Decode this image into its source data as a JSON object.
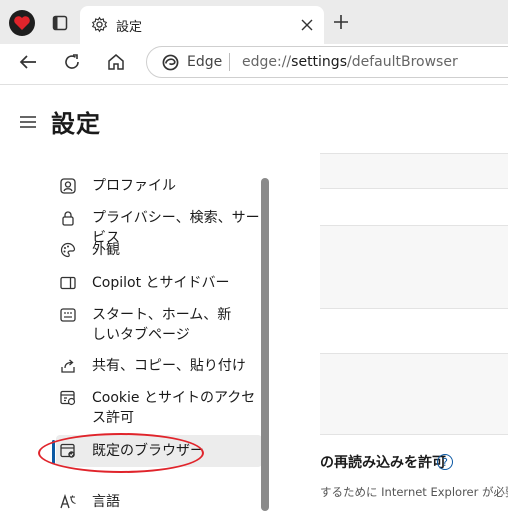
{
  "tab": {
    "title": "設定"
  },
  "address": {
    "brand": "Edge",
    "url_prefix": "edge://",
    "url_host": "settings",
    "url_path": "/defaultBrowser"
  },
  "page": {
    "title": "設定"
  },
  "sidebar": {
    "items": [
      {
        "label": "プロファイル",
        "icon": "profile-icon"
      },
      {
        "label": "プライバシー、検索、サービス",
        "icon": "lock-icon"
      },
      {
        "label": "外観",
        "icon": "palette-icon"
      },
      {
        "label": "Copilot とサイドバー",
        "icon": "sidebar-icon"
      },
      {
        "label": "スタート、ホーム、新しいタブページ",
        "icon": "start-page-icon"
      },
      {
        "label": "共有、コピー、貼り付け",
        "icon": "share-icon"
      },
      {
        "label": "Cookie とサイトのアクセス許可",
        "icon": "site-permissions-icon"
      },
      {
        "label": "既定のブラウザー",
        "icon": "default-browser-icon",
        "selected": true
      },
      {
        "label": "言語",
        "icon": "language-icon"
      }
    ]
  },
  "main": {
    "setting_label": "の再読み込みを許可",
    "setting_sub": "するために Internet Explorer が必要な"
  },
  "colors": {
    "accent": "#0c59a4",
    "highlight": "#e0242b"
  }
}
